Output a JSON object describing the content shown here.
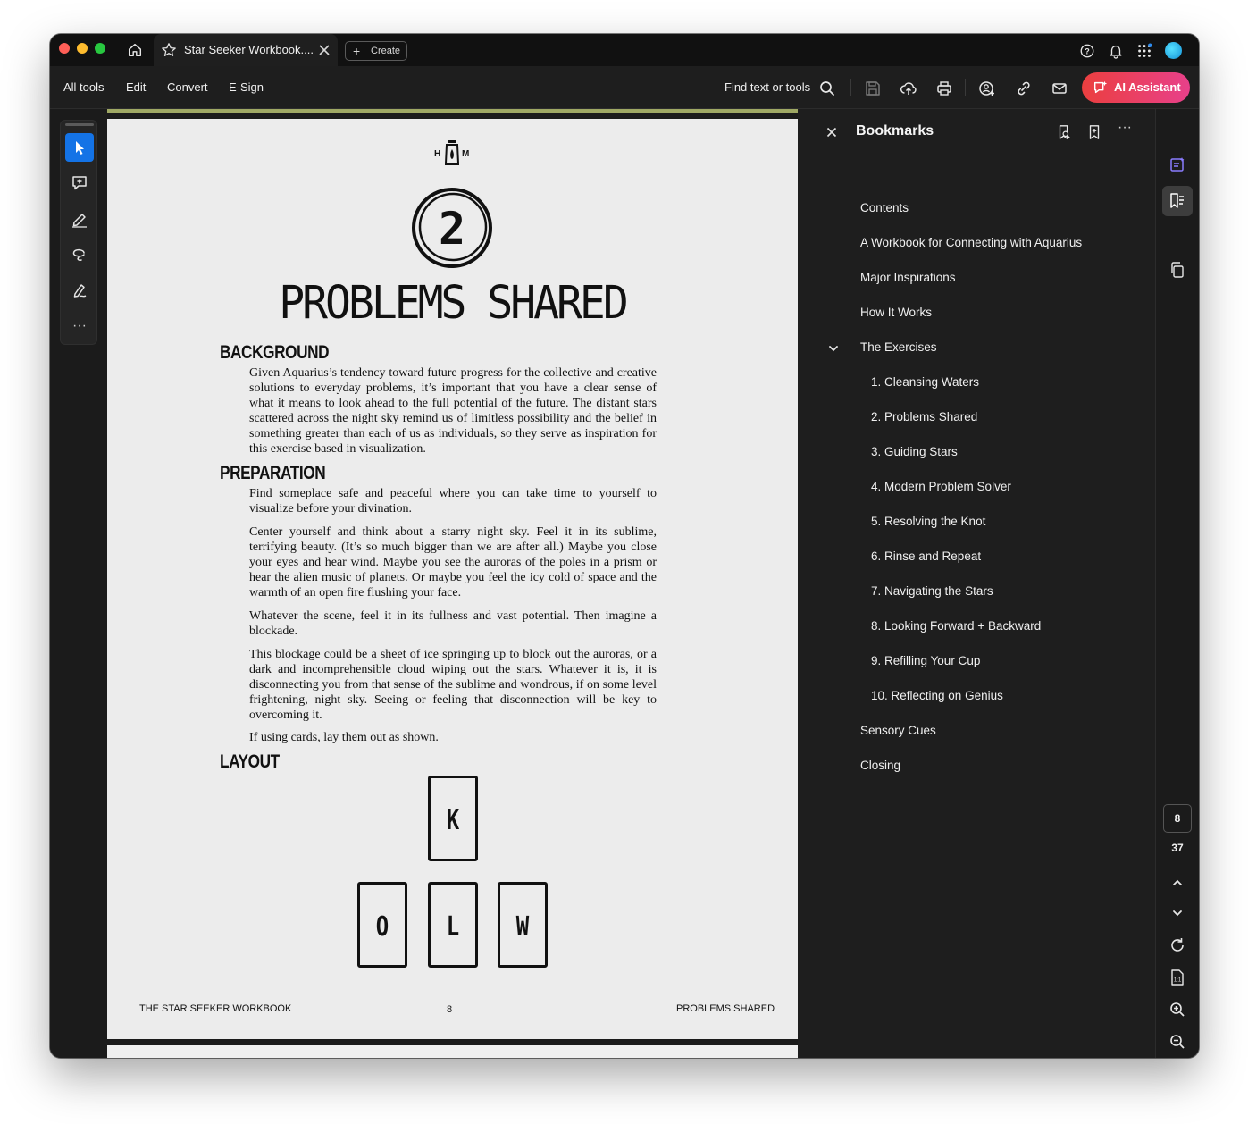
{
  "titlebar": {
    "tab_title": "Star Seeker Workbook....",
    "create_label": "Create"
  },
  "menubar": {
    "items": [
      "All tools",
      "Edit",
      "Convert",
      "E-Sign"
    ],
    "find_label": "Find text or tools",
    "ai_label": "AI Assistant"
  },
  "document": {
    "logo_letters": "H M",
    "chapter_number": "2",
    "chapter_title": "PROBLEMS SHARED",
    "sections": {
      "background": "BACKGROUND",
      "preparation": "PREPARATION",
      "layout": "LAYOUT"
    },
    "paragraphs": {
      "background": "Given Aquarius’s tendency toward future progress for the collective and creative solutions to everyday problems, it’s important that you have a clear sense of what it means to look ahead to the full potential of the future. The distant stars scattered across the night sky remind us of limitless possibility and the belief in something greater than each of us as individuals, so they serve as inspiration for this exercise based in visualization.",
      "prep1": "Find someplace safe and peaceful where you can take time to yourself to visualize before your divination.",
      "prep2": "Center yourself and think about a starry night sky. Feel it in its sublime, terrifying beauty. (It’s so much bigger than we are after all.) Maybe you close your eyes and hear wind. Maybe you see the auroras of the poles in a prism or hear the alien music of planets. Or maybe you feel the icy cold of space and the warmth of an open fire flushing your face.",
      "prep3": "Whatever the scene, feel it in its fullness and vast potential. Then imagine a blockade.",
      "prep4": "This blockage could be a sheet of ice springing up to block out the auroras, or a dark and incomprehensible cloud wiping out the stars. Whatever it is, it is disconnecting you from that sense of the sublime and wondrous, if on some level frightening, night sky. Seeing or feeling that disconnection will be key to overcoming it.",
      "prep5": "If using cards, lay them out as shown."
    },
    "cards": [
      "K",
      "O",
      "L",
      "W"
    ],
    "footer": {
      "left": "THE STAR SEEKER WORKBOOK",
      "page": "8",
      "right": "PROBLEMS SHARED"
    }
  },
  "bookmarks": {
    "title": "Bookmarks",
    "items": [
      "Contents",
      "A Workbook for Connecting with Aquarius",
      "Major Inspirations",
      "How It Works",
      "The Exercises",
      "1. Cleansing Waters",
      "2. Problems Shared",
      "3. Guiding Stars",
      "4. Modern Problem Solver",
      "5. Resolving the Knot",
      "6. Rinse and Repeat",
      "7. Navigating the Stars",
      "8. Looking Forward + Backward",
      "9. Refilling Your Cup",
      "10. Reflecting on Genius",
      "Sensory Cues",
      "Closing"
    ]
  },
  "pagenav": {
    "current": "8",
    "total": "37"
  },
  "colors": {
    "accent_blue": "#1473e6",
    "ai_gradient_start": "#eb3f3f",
    "ai_gradient_end": "#e8408a"
  }
}
